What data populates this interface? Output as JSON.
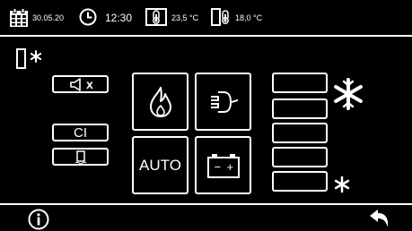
{
  "status": {
    "date": "30.05.20",
    "time": "12:30",
    "inside_temp": "23,5 °C",
    "outside_temp": "18,0 °C"
  },
  "main": {
    "mute_label": "x",
    "ci_label": "CI",
    "auto_label": "AUTO",
    "battery_minus": "−",
    "battery_plus": "+"
  },
  "icons": {
    "calendar": "calendar-icon",
    "clock": "clock-icon",
    "inside_thermometer": "thermometer-inside-icon",
    "outside_thermometer": "thermometer-outside-icon",
    "fridge_snowflake": "fridge-freezer-icon",
    "mute": "speaker-mute-icon",
    "fridge": "fridge-icon",
    "flame": "flame-icon",
    "plug": "plug-icon",
    "battery": "battery-icon",
    "snowflake_large": "snowflake-large-icon",
    "snowflake_small": "snowflake-small-icon",
    "info": "info-icon",
    "back": "back-arrow-icon"
  },
  "colors": {
    "background": "#000000",
    "foreground": "#ffffff"
  }
}
